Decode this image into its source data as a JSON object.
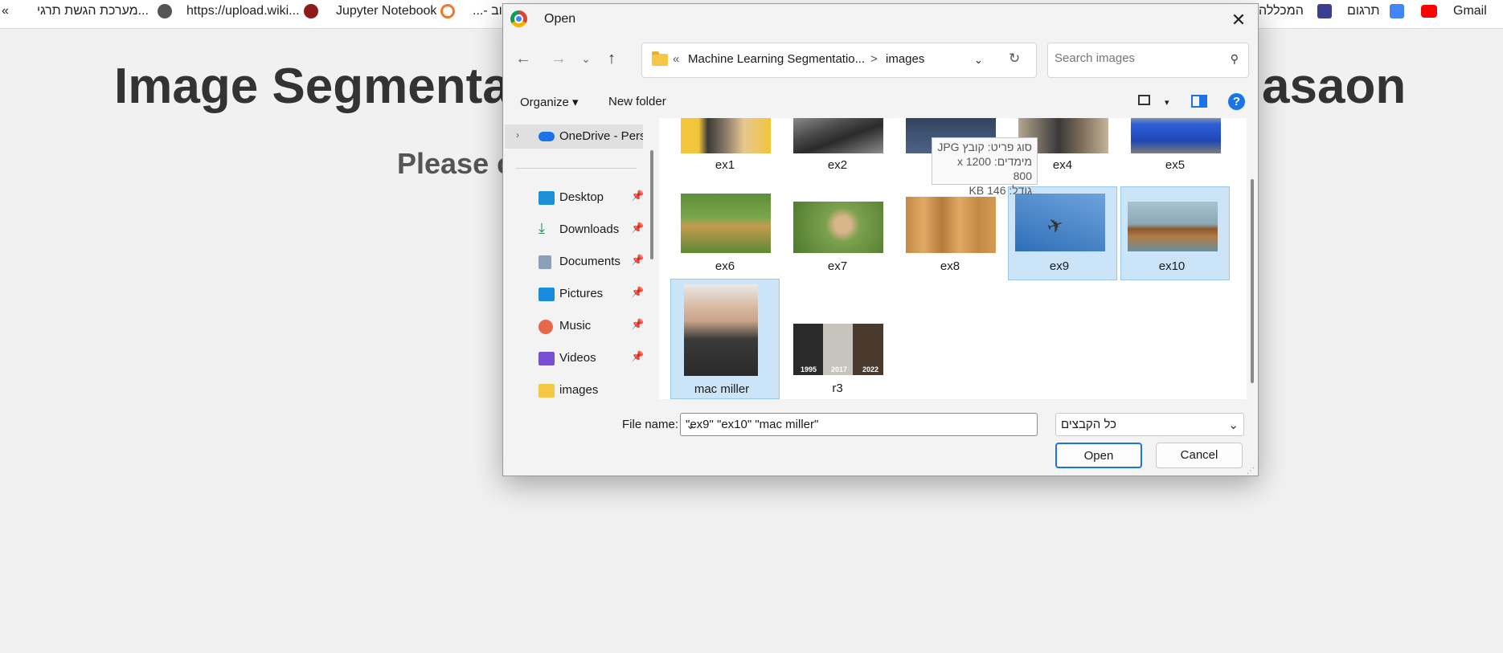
{
  "bookmarks": {
    "overflow": "«",
    "item_heb1": "מערכת הגשת תרגי...",
    "item_upload": "https://upload.wiki...",
    "item_jupyter": "Jupyter Notebook",
    "item_dots": "...- וב",
    "item_heb2": "המכללה",
    "item_translate": "תרגום",
    "item_gmail": "Gmail"
  },
  "page": {
    "title_left": "Image Segmentat",
    "title_right": "asaon",
    "subtitle": "Please c"
  },
  "dialog": {
    "title": "Open",
    "breadcrumb": {
      "prefix": "«",
      "parent": "Machine Learning Segmentatio...",
      "separator": ">",
      "current": "images"
    },
    "search_placeholder": "Search images",
    "toolbar": {
      "organize": "Organize",
      "new_folder": "New folder",
      "help": "?"
    },
    "sidebar": {
      "onedrive": "OneDrive - Perso",
      "items": [
        {
          "label": "Desktop",
          "icon": "desktop-icon"
        },
        {
          "label": "Downloads",
          "icon": "download-icon"
        },
        {
          "label": "Documents",
          "icon": "documents-icon"
        },
        {
          "label": "Pictures",
          "icon": "pictures-icon"
        },
        {
          "label": "Music",
          "icon": "music-icon"
        },
        {
          "label": "Videos",
          "icon": "videos-icon"
        },
        {
          "label": "images",
          "icon": "folder-icon"
        }
      ]
    },
    "files": [
      {
        "name": "ex1",
        "selected": false
      },
      {
        "name": "ex2",
        "selected": false
      },
      {
        "name": "",
        "selected": false
      },
      {
        "name": "ex4",
        "selected": false
      },
      {
        "name": "ex5",
        "selected": false
      },
      {
        "name": "ex6",
        "selected": false
      },
      {
        "name": "ex7",
        "selected": false
      },
      {
        "name": "ex8",
        "selected": false
      },
      {
        "name": "ex9",
        "selected": true
      },
      {
        "name": "ex10",
        "selected": true
      },
      {
        "name": "mac miller",
        "selected": true
      },
      {
        "name": "r3",
        "selected": false
      }
    ],
    "r3_years": [
      "1995",
      "2017",
      "2022"
    ],
    "tooltip": {
      "type": "סוג פריט: קובץ JPG",
      "dims": "מימדים: 1200 x 800",
      "size": "גודל: 146 KB"
    },
    "file_name_label": "File name:",
    "file_name_value": "\"ex9\" \"ex10\" \"mac miller\"",
    "file_type": "כל הקבצים",
    "open_button": "Open",
    "cancel_button": "Cancel"
  }
}
